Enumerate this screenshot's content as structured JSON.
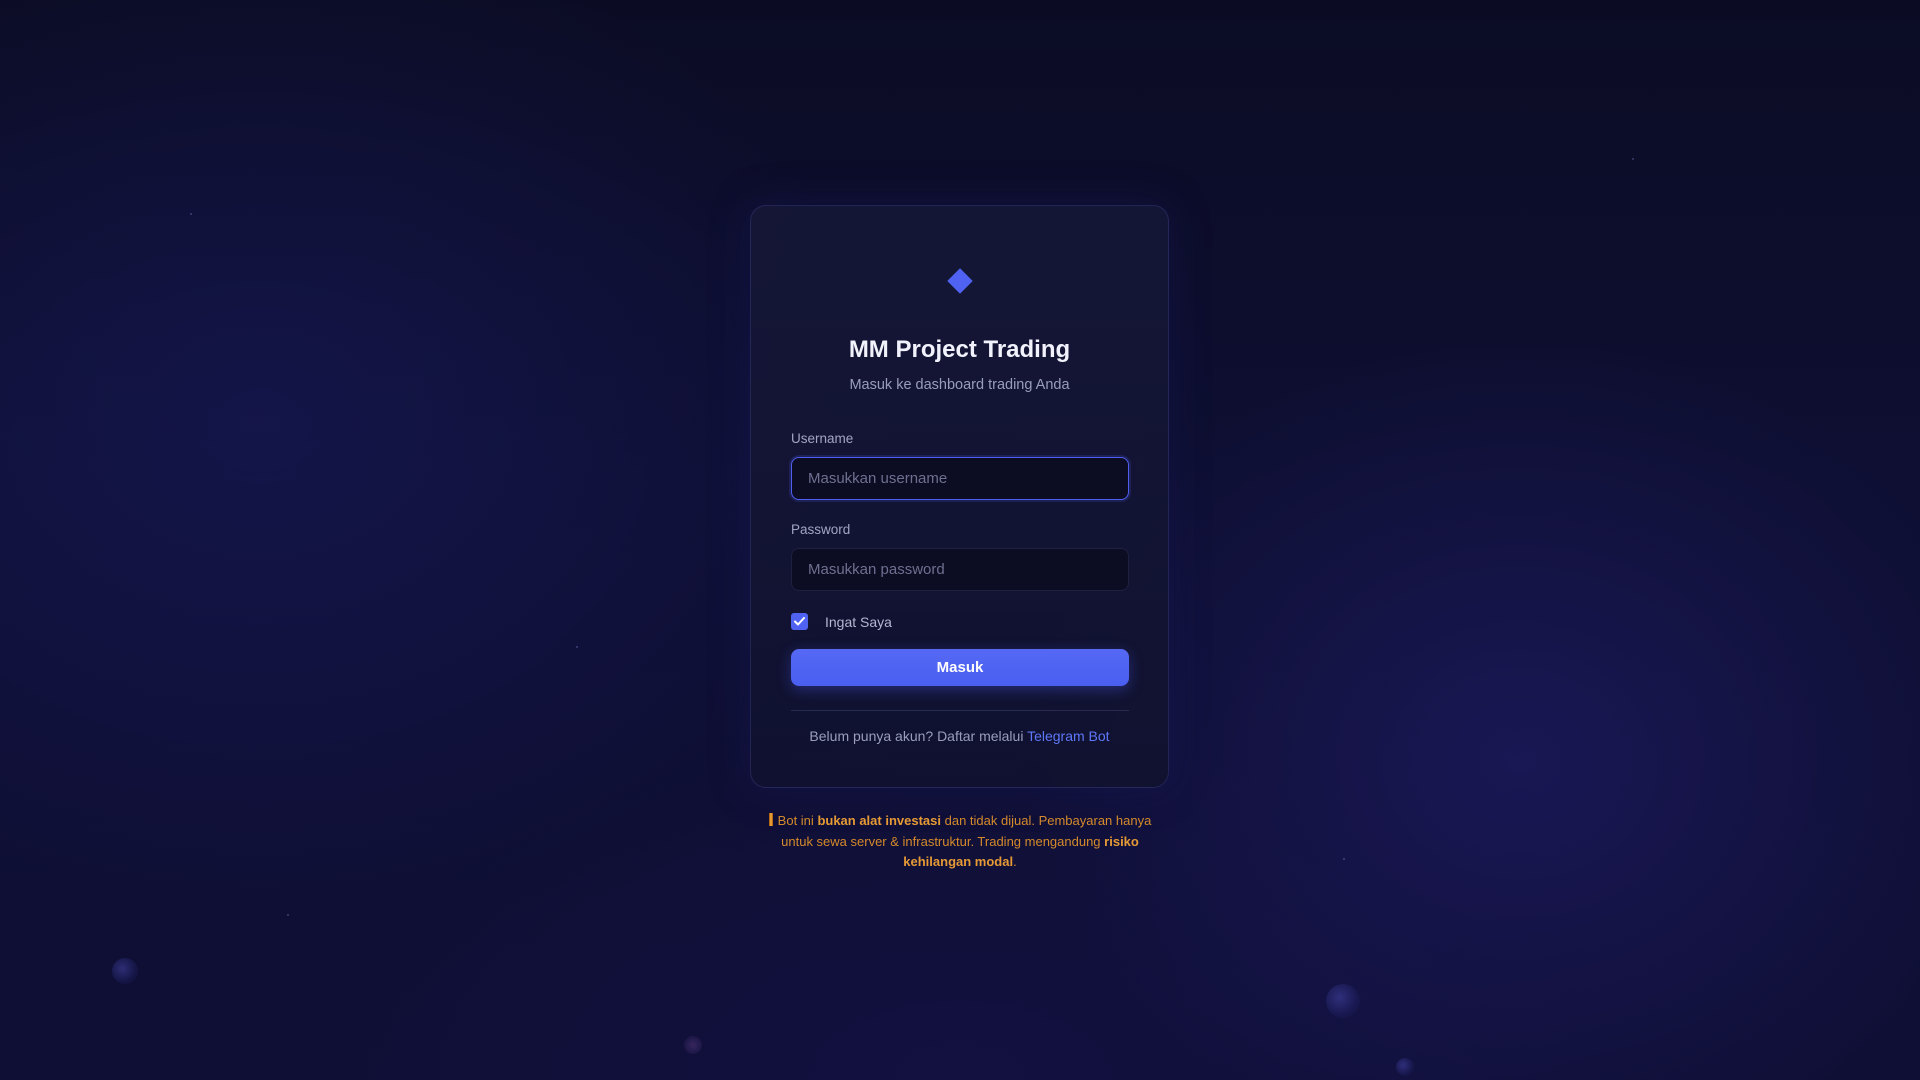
{
  "app": {
    "title": "MM Project Trading",
    "subtitle": "Masuk ke dashboard trading Anda"
  },
  "form": {
    "username_label": "Username",
    "username_placeholder": "Masukkan username",
    "username_value": "",
    "password_label": "Password",
    "password_placeholder": "Masukkan password",
    "password_value": "",
    "remember_label": "Ingat Saya",
    "remember_checked": true,
    "submit_label": "Masuk"
  },
  "register": {
    "text": "Belum punya akun? Daftar melalui",
    "link_label": "Telegram Bot"
  },
  "disclaimer": {
    "part1": "Bot ini",
    "bold1": "bukan alat investasi",
    "part2": "dan tidak dijual. Pembayaran hanya untuk sewa server & infrastruktur. Trading mengandung",
    "bold2": "risiko kehilangan modal",
    "part3": "."
  },
  "colors": {
    "accent": "#4f62f2",
    "link": "#5d77f7",
    "warning": "#e69a35",
    "background": "#0c0d2c"
  },
  "icons": {
    "logo": "diamond-icon",
    "checkbox": "checkmark-icon",
    "warning": "warning-icon"
  }
}
